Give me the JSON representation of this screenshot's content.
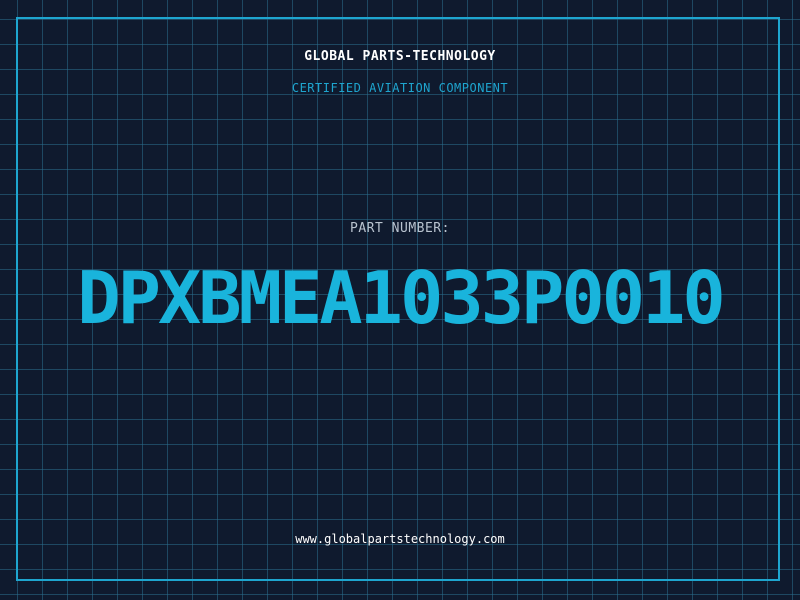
{
  "header": {
    "brand": "GLOBAL PARTS-TECHNOLOGY",
    "subtitle": "CERTIFIED AVIATION COMPONENT"
  },
  "part": {
    "label": "PART NUMBER:",
    "number": "DPXBMEA1033P0010"
  },
  "footer": {
    "url": "www.globalpartstechnology.com"
  },
  "colors": {
    "background": "#0f1a2e",
    "grid": "#2a6e8c",
    "accent": "#1ea5cf",
    "part_number": "#19b4dc",
    "text": "#ffffff"
  }
}
